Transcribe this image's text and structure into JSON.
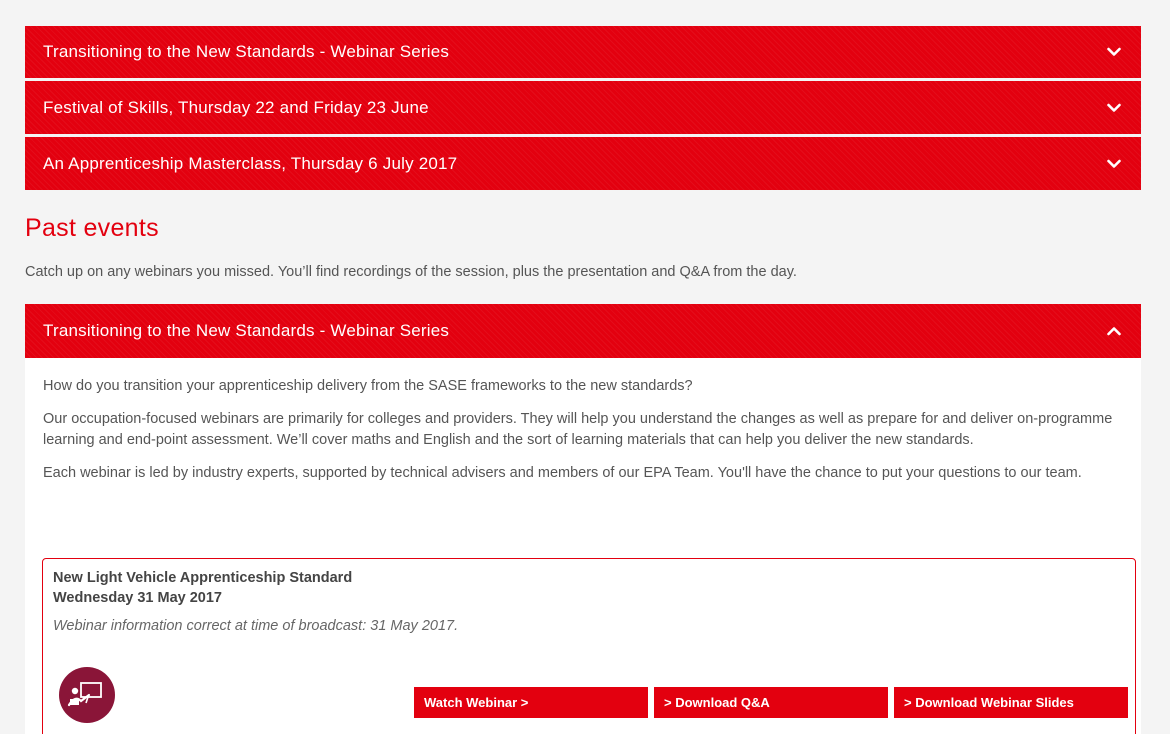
{
  "upcoming": [
    {
      "title": "Transitioning to the New Standards - Webinar Series",
      "icon": "chevron-down-icon"
    },
    {
      "title": "Festival of Skills, Thursday 22 and Friday 23 June",
      "icon": "chevron-down-icon"
    },
    {
      "title": "An Apprenticeship Masterclass, Thursday 6 July 2017",
      "icon": "chevron-down-icon"
    }
  ],
  "past": {
    "heading": "Past events",
    "intro": "Catch up on any webinars you missed. You’ll find recordings of the session, plus the presentation and Q&A from the day.",
    "open_panel": {
      "title": "Transitioning to the New Standards - Webinar Series",
      "icon": "chevron-up-icon",
      "paragraphs": [
        "How do you transition your apprenticeship delivery from the SASE frameworks to the new standards?",
        "Our occupation-focused webinars are primarily for colleges and providers. They will help you understand the changes as well as prepare for and deliver on-programme learning and end-point assessment. We’ll cover maths and English and the sort of learning materials that can help you deliver the new standards.",
        "Each webinar is led by industry experts, supported by technical advisers and members of our EPA Team. You'll have the chance to put your questions to our team."
      ],
      "webinar": {
        "title": "New Light Vehicle Apprenticeship Standard",
        "date": "Wednesday 31 May 2017",
        "note": "Webinar information correct at time of broadcast: 31 May 2017.",
        "icon": "presentation-icon",
        "buttons": {
          "watch": "Watch Webinar >",
          "qa": "> Download Q&A",
          "slides": "> Download Webinar Slides"
        }
      }
    }
  },
  "colors": {
    "accent": "#e3000f",
    "icon_bg": "#8a1538",
    "page_bg": "#f4f4f4"
  }
}
